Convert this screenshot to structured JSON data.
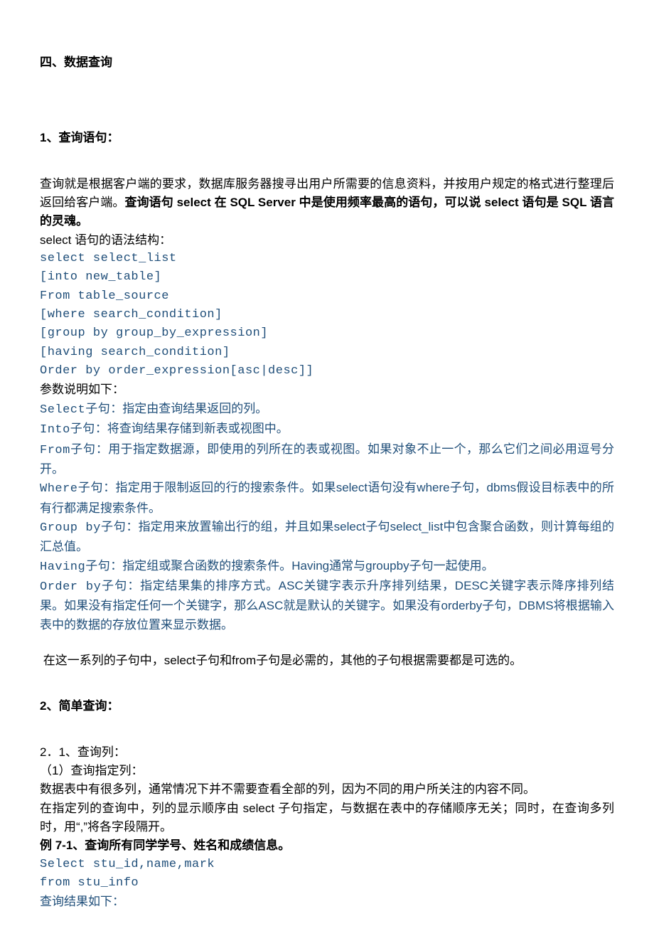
{
  "title1": "四、数据查询",
  "sec1_title": "1、查询语句：",
  "p1a": "查询就是根据客户端的要求，数据库服务器搜寻出用户所需要的信息资料，并按用户规定的格式进行整理后返回给客户端。",
  "p1b": "查询语句 select 在 SQL Server 中是使用频率最高的语句，可以说 select 语句是 SQL 语言的灵魂。",
  "p2": "select 语句的语法结构：",
  "c1": "select select_list",
  "c2": "[into new_table]",
  "c3": "From table_source",
  "c4": "[where search_condition]",
  "c5": "[group by group_by_expression]",
  "c6": "[having search_condition]",
  "c7": "Order by order_expression[asc|desc]]",
  "p3": "参数说明如下：",
  "d1a": "Select子句",
  "d1b": "：指定由查询结果返回的列。",
  "d2a": "Into子句",
  "d2b": "：将查询结果存储到新表或视图中。",
  "d3a": "From子句",
  "d3b": "：用于指定数据源，即使用的列所在的表或视图。如果对象不止一个，那么它们之间必用逗号分开。",
  "d4a": "Where子句",
  "d4b": "：指定用于限制返回的行的搜索条件。如果select语句没有where子句，dbms假设目标表中的所有行都满足搜索条件。",
  "d5a": "Group by子句",
  "d5b": "：指定用来放置输出行的组，并且如果select子句select_list中包含聚合函数，则计算每组的汇总值。",
  "d6a": "Having子句",
  "d6b": "：指定组或聚合函数的搜索条件。Having通常与groupby子句一起使用。",
  "d7a": "Order by子句",
  "d7b": "：指定结果集的排序方式。ASC关键字表示升序排列结果，DESC关键字表示降序排列结果。如果没有指定任何一个关键字，那么ASC就是默认的关键字。如果没有orderby子句，DBMS将根据输入表中的数据的存放位置来显示数据。",
  "p4": " 在这一系列的子句中，select子句和from子句是必需的，其他的子句根据需要都是可选的。",
  "sec2_title": "2、简单查询：",
  "s2_1": "2．1、查询列：",
  "s2_2": "（1）查询指定列：",
  "s2_3": "数据表中有很多列，通常情况下并不需要查看全部的列，因为不同的用户所关注的内容不同。",
  "s2_4": "在指定列的查询中，列的显示顺序由 select 子句指定，与数据在表中的存储顺序无关；同时，在查询多列时，用“,”将各字段隔开。",
  "s2_5": "例 7-1、查询所有同学学号、姓名和成绩信息。",
  "s2_c1": "Select stu_id,name,mark",
  "s2_c2": "from stu_info",
  "s2_6": "查询结果如下："
}
